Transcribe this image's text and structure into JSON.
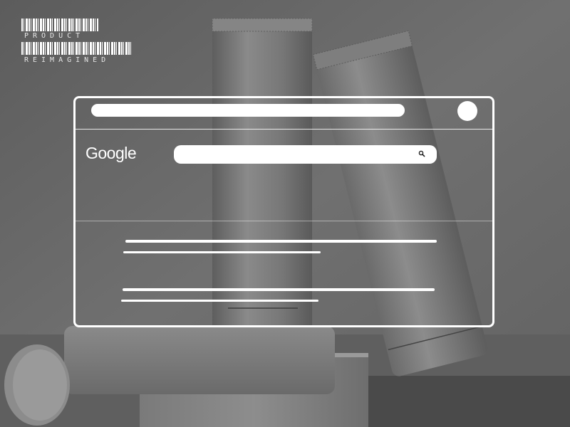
{
  "brand": {
    "line1": "PRODUCT",
    "line2": "REIMAGINED"
  },
  "browser": {
    "logo_text": "Google",
    "search_icon": "magnifier-icon",
    "address_bar_icon": "none",
    "profile_icon": "avatar-circle"
  },
  "colors": {
    "background": "#6b6b6b",
    "wireframe": "#ffffff"
  }
}
